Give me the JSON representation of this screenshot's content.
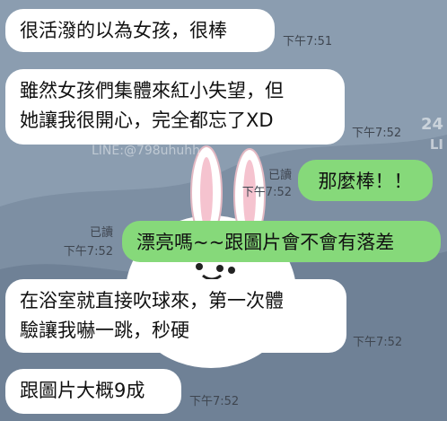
{
  "messages": [
    {
      "text": "很活潑的以為女孩，很棒",
      "time": "下午7:51"
    },
    {
      "line1": "雖然女孩們集體來紅小失望，但",
      "line2": "她讓我很開心，完全都忘了XD",
      "time": "下午7:52"
    },
    {
      "text": "那麼棒！！",
      "read": "已讀",
      "time": "下午7:52"
    },
    {
      "text": "漂亮嗎~~跟圖片會不會有落差",
      "read": "已讀",
      "time": "下午7:52"
    },
    {
      "line1": "在浴室就直接吹球來，第一次體",
      "line2": "驗讓我嚇一跳，秒硬",
      "time": "下午7:52"
    },
    {
      "text": "跟圖片大概9成",
      "time": "下午7:52"
    }
  ],
  "watermark": "LINE:@798uhuhh",
  "side_marks": [
    "24",
    "LI"
  ],
  "colors": {
    "background": "#7d8fa3",
    "incoming": "#ffffff",
    "outgoing": "#86d97a"
  }
}
